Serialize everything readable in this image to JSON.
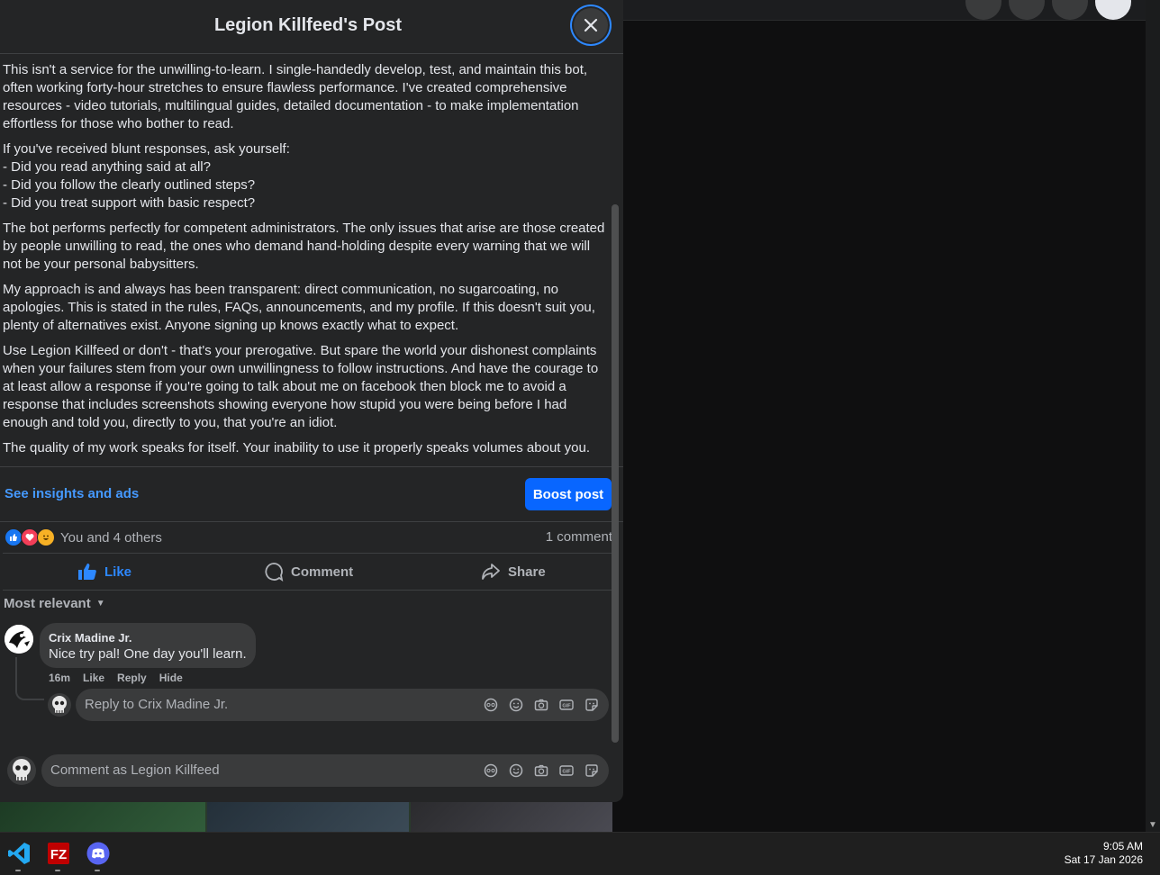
{
  "dialog": {
    "title": "Legion Killfeed's Post",
    "close_icon": "close-icon"
  },
  "post": {
    "paragraphs": [
      "This isn't a service for the unwilling-to-learn. I single-handedly develop, test, and maintain this bot, often working forty-hour stretches to ensure flawless performance. I've created comprehensive resources - video tutorials, multilingual guides, detailed documentation - to make implementation effortless for those who bother to read.",
      "If you've received blunt responses, ask yourself:\n- Did you read anything said at all?\n- Did you follow the clearly outlined steps?\n- Did you treat support with basic respect?",
      "The bot performs perfectly for competent administrators. The only issues that arise are those created by people unwilling to read, the ones who demand hand-holding despite every warning that we will not be your personal babysitters.",
      "My approach is and always has been transparent: direct communication, no sugarcoating, no apologies. This is stated in the rules, FAQs, announcements, and my profile. If this doesn't suit you, plenty of alternatives exist. Anyone signing up knows exactly what to expect.",
      "Use Legion Killfeed or don't - that's your prerogative. But spare the world your dishonest complaints when your failures stem from your own unwillingness to follow instructions. And have the courage to at least allow a response if you're going to talk about me on facebook then block me to avoid a response that includes screenshots showing everyone how stupid you were being before I had enough and told you, directly to you, that you're an idiot.",
      "The quality of my work speaks for itself. Your inability to use it properly speaks volumes about you."
    ]
  },
  "insights": {
    "link_label": "See insights and ads",
    "boost_label": "Boost post"
  },
  "stats": {
    "reaction_icons": [
      "like-reaction-icon",
      "love-reaction-icon",
      "haha-reaction-icon"
    ],
    "reactions_text": "You and 4 others",
    "comments_text": "1 comment"
  },
  "actions": {
    "like": "Like",
    "comment": "Comment",
    "share": "Share"
  },
  "comments": {
    "sort_label": "Most relevant",
    "items": [
      {
        "author": "Crix Madine Jr.",
        "text": "Nice try pal! One day you'll learn.",
        "time": "16m",
        "like": "Like",
        "reply": "Reply",
        "hide": "Hide"
      }
    ],
    "reply_placeholder": "Reply to Crix Madine Jr."
  },
  "composer": {
    "placeholder": "Comment as Legion Killfeed"
  },
  "taskbar": {
    "apps": [
      "vscode-icon",
      "filezilla-icon",
      "discord-icon"
    ],
    "time": "9:05 AM",
    "date": "Sat 17 Jan 2026"
  },
  "colors": {
    "accent": "#2d88ff",
    "boost": "#0866ff",
    "link": "#4599ff",
    "dialog_bg": "#242526"
  }
}
